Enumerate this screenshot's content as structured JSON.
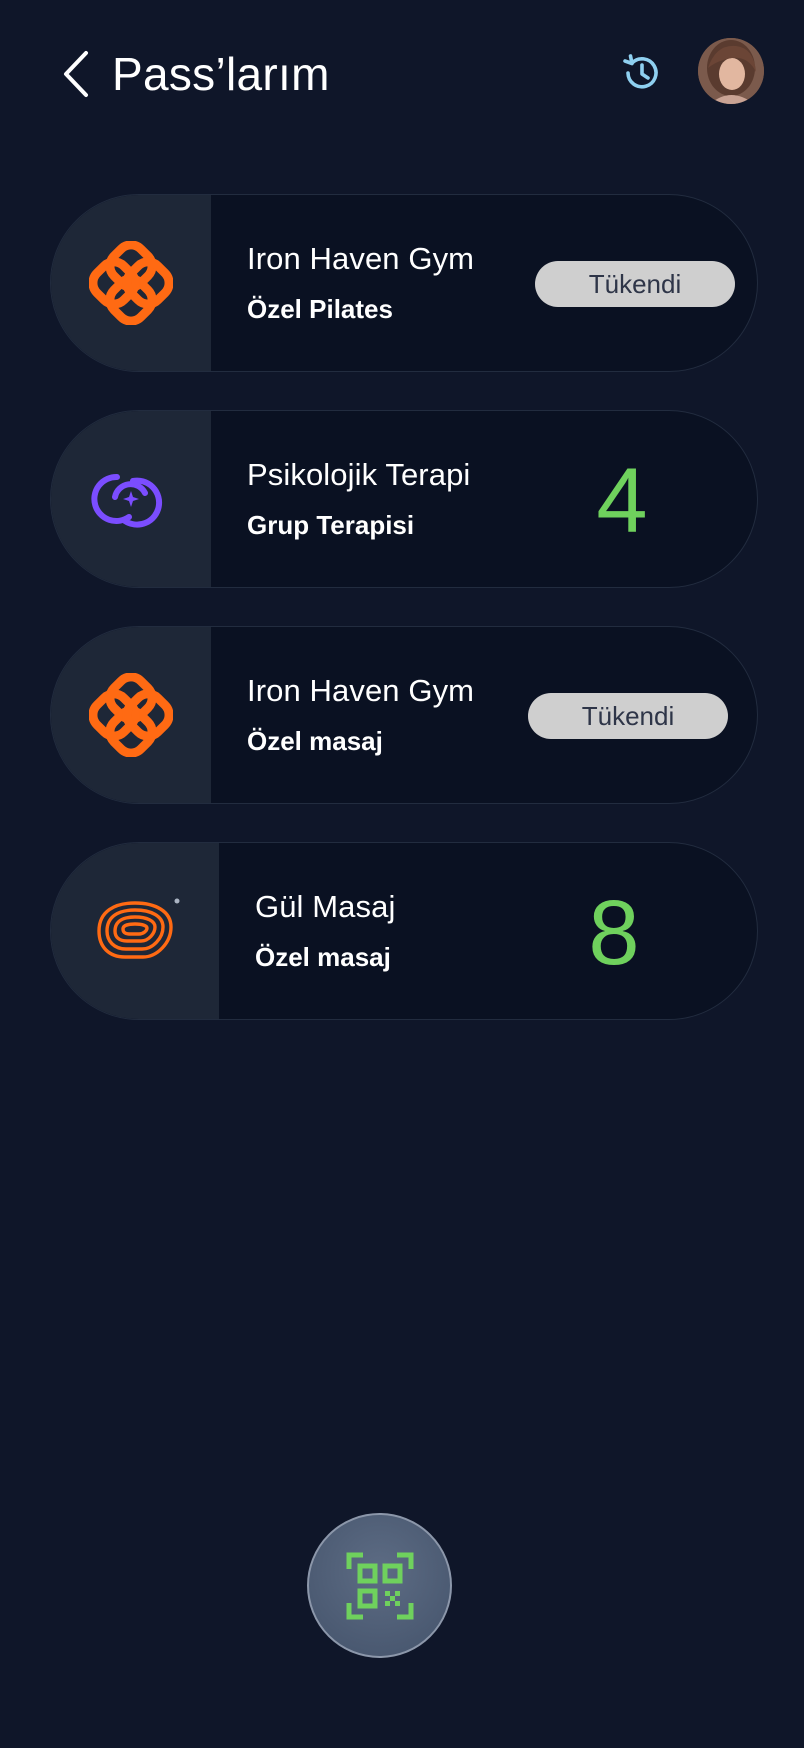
{
  "header": {
    "title": "Pass’larım",
    "back_icon": "chevron-left-icon",
    "history_icon": "history-icon",
    "avatar_alt": "user avatar"
  },
  "colors": {
    "background": "#0f1629",
    "card": "#0a1122",
    "logo_panel": "#1e2737",
    "accent_green": "#6fd15d",
    "brand_orange": "#ff6a13",
    "brand_purple": "#7b4dff",
    "badge": "#cfcfcf",
    "history_icon": "#8fd0f0"
  },
  "passes": [
    {
      "venue": "Iron Haven Gym",
      "service": "Özel Pilates",
      "status": "Tükendi",
      "logo": "iron-haven-logo-icon"
    },
    {
      "venue": "Psikolojik Terapi",
      "service": "Grup Terapisi",
      "remaining": "4",
      "logo": "psikolojik-terapi-logo-icon"
    },
    {
      "venue": "Iron Haven Gym",
      "service": "Özel masaj",
      "status": "Tükendi",
      "logo": "iron-haven-logo-icon"
    },
    {
      "venue": "Gül Masaj",
      "service": "Özel masaj",
      "remaining": "8",
      "logo": "gul-masaj-logo-icon"
    }
  ],
  "qr_button": {
    "icon": "qr-scan-icon"
  }
}
